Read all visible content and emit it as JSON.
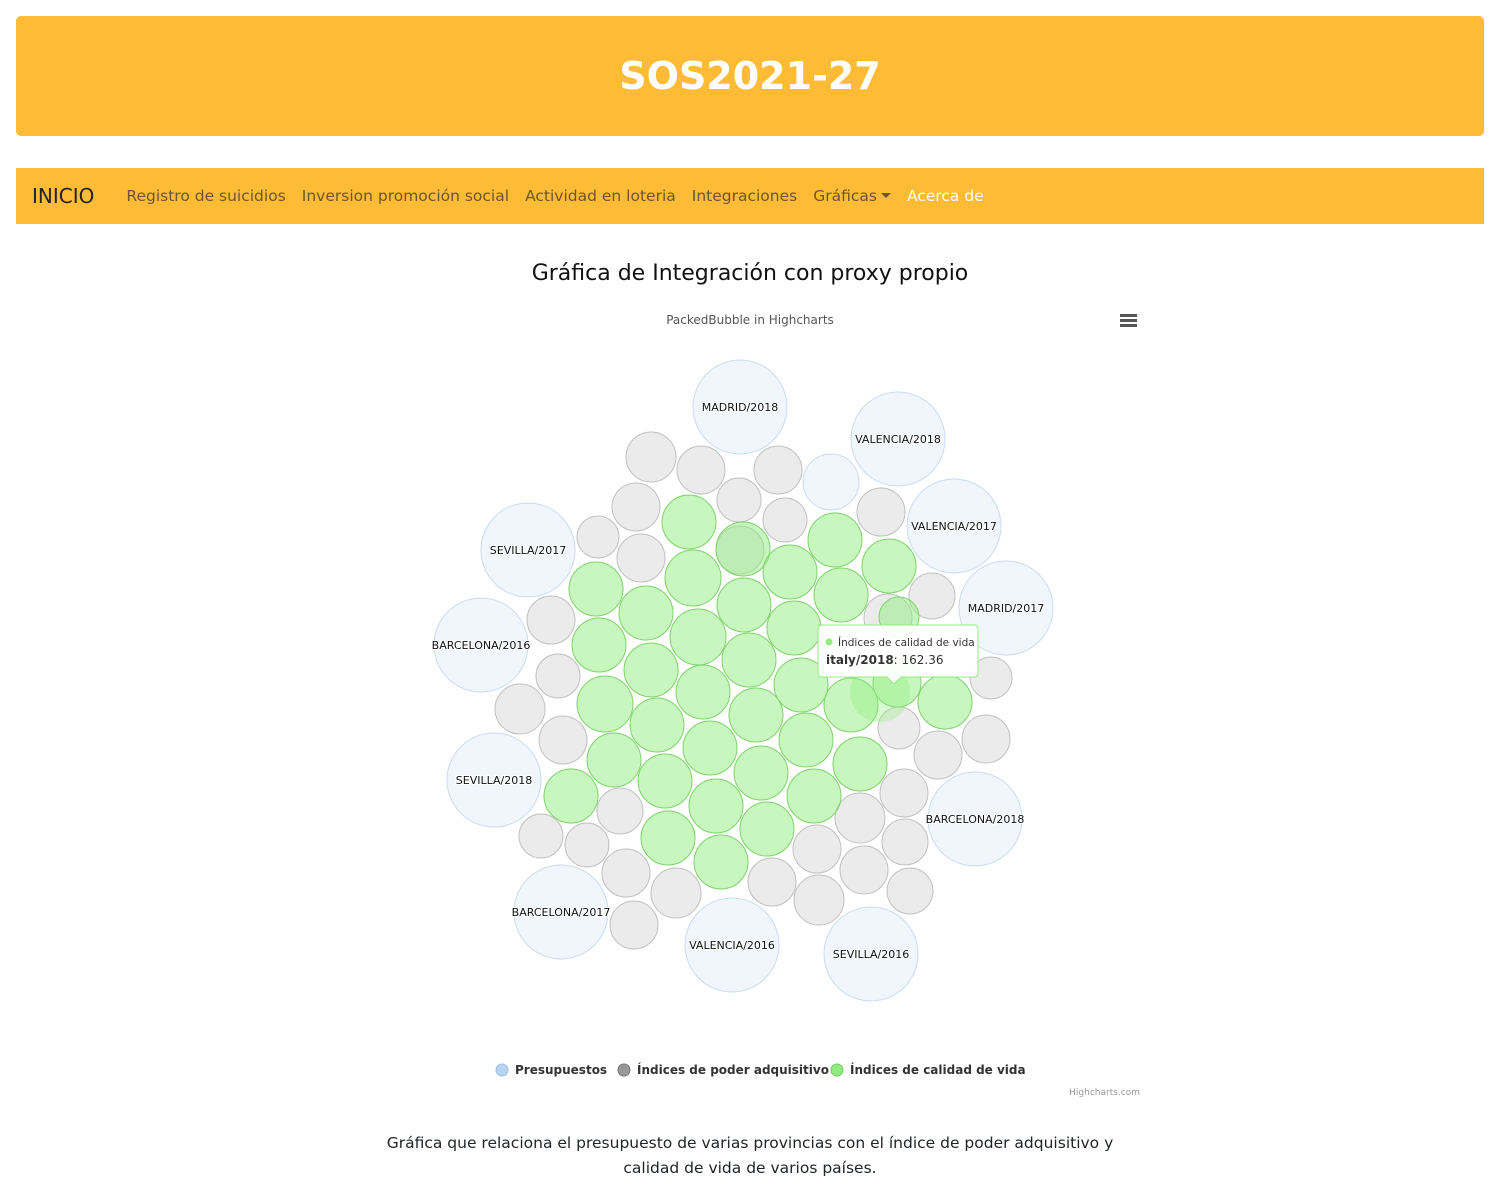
{
  "header": {
    "title": "SOS2021-27"
  },
  "navbar": {
    "brand": "INICIO",
    "items": [
      {
        "label": "Registro de suicidios"
      },
      {
        "label": "Inversion promoción social"
      },
      {
        "label": "Actividad en loteria"
      },
      {
        "label": "Integraciones"
      },
      {
        "label": "Gráficas",
        "dropdown": true
      },
      {
        "label": "Acerca de",
        "active": true
      }
    ]
  },
  "colors": {
    "brand": "#febb35",
    "presupuestos": "#b8d3f0",
    "poder": "#999999",
    "calidad": "#90ed7d"
  },
  "chart_data": {
    "type": "packedbubble",
    "title": "Gráfica de Integración con proxy propio",
    "subtitle": "PackedBubble in Highcharts",
    "credits": "Highcharts.com",
    "legend_position": "bottom-center",
    "series": [
      {
        "name": "Presupuestos",
        "color": "#b8d3f0",
        "points": [
          {
            "label": "MADRID/2018"
          },
          {
            "label": "VALENCIA/2018"
          },
          {
            "label": "VALENCIA/2017"
          },
          {
            "label": "MADRID/2017"
          },
          {
            "label": "SEVILLA/2017"
          },
          {
            "label": "BARCELONA/2016"
          },
          {
            "label": "SEVILLA/2018"
          },
          {
            "label": "BARCELONA/2018"
          },
          {
            "label": "BARCELONA/2017"
          },
          {
            "label": "VALENCIA/2016"
          },
          {
            "label": "SEVILLA/2016"
          },
          {
            "label": ""
          }
        ]
      },
      {
        "name": "Índices de poder adquisitivo",
        "color": "#999999",
        "point_count": 46
      },
      {
        "name": "Índices de calidad de vida",
        "color": "#90ed7d",
        "point_count": 39
      }
    ],
    "tooltip": {
      "series": "Índices de calidad de vida",
      "point": "italy/2018",
      "value": "162.36"
    }
  },
  "caption": "Gráfica que relaciona el presupuesto de varias provincias con el índice de poder adquisitivo y calidad de vida de varios países."
}
